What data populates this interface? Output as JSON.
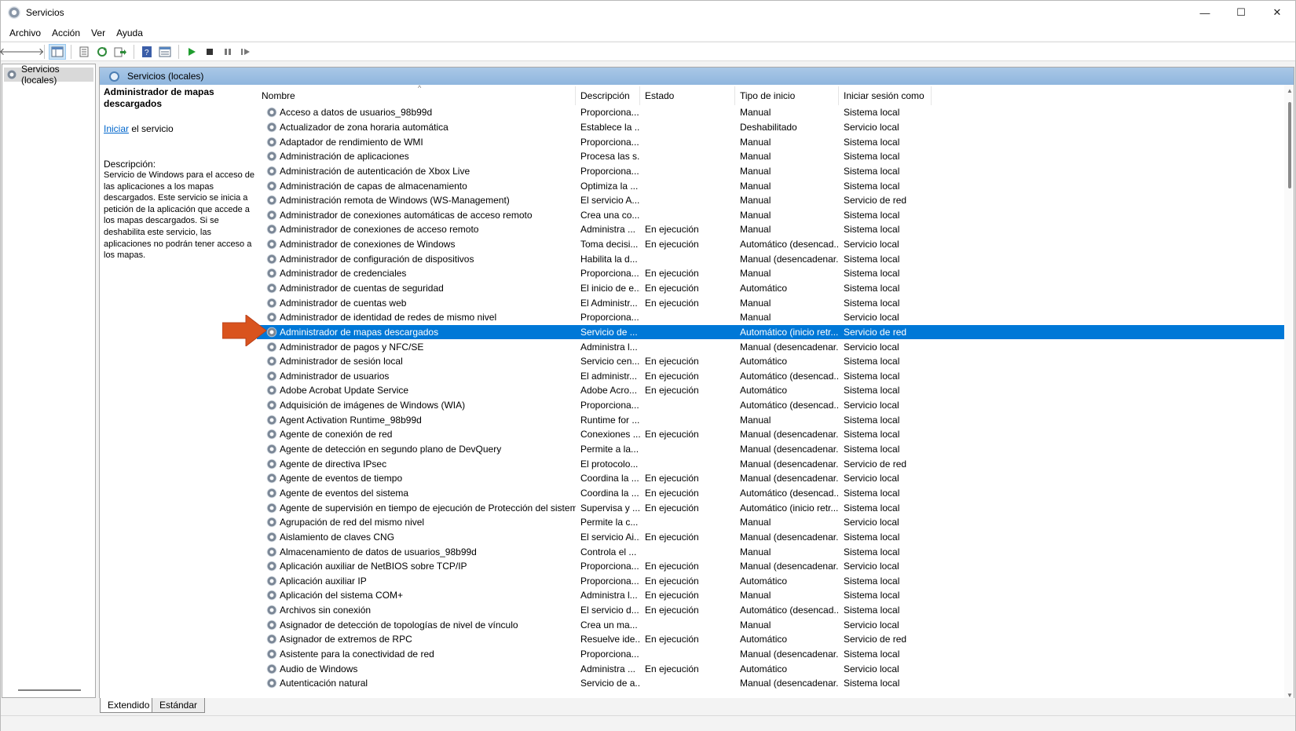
{
  "window": {
    "title": "Servicios"
  },
  "titlebar_buttons": {
    "minimize": "—",
    "maximize": "☐",
    "close": "✕"
  },
  "menu": [
    "Archivo",
    "Acción",
    "Ver",
    "Ayuda"
  ],
  "toolbar": [
    "back-icon",
    "forward-icon",
    "console-tree-icon",
    "properties-icon",
    "refresh-icon",
    "export-list-icon",
    "help-icon",
    "details-view-icon",
    "start-service-icon",
    "stop-service-icon",
    "pause-service-icon",
    "resume-service-icon"
  ],
  "tree": {
    "root_label": "Servicios (locales)"
  },
  "content": {
    "header_title": "Servicios (locales)"
  },
  "extended": {
    "title": "Administrador de mapas descargados",
    "action_link": "Iniciar",
    "action_suffix": " el servicio",
    "description_label": "Descripción:",
    "description": "Servicio de Windows para el acceso de las aplicaciones a los mapas descargados. Este servicio se inicia a petición de la aplicación que accede a los mapas descargados. Si se deshabilita este servicio, las aplicaciones no podrán tener acceso a los mapas."
  },
  "columns": {
    "name": "Nombre",
    "description": "Descripción",
    "status": "Estado",
    "startup": "Tipo de inicio",
    "logon": "Iniciar sesión como"
  },
  "services": [
    [
      "Acceso a datos de usuarios_98b99d",
      "Proporciona...",
      "",
      "Manual",
      "Sistema local"
    ],
    [
      "Actualizador de zona horaria automática",
      "Establece la ...",
      "",
      "Deshabilitado",
      "Servicio local"
    ],
    [
      "Adaptador de rendimiento de WMI",
      "Proporciona...",
      "",
      "Manual",
      "Sistema local"
    ],
    [
      "Administración de aplicaciones",
      "Procesa las s...",
      "",
      "Manual",
      "Sistema local"
    ],
    [
      "Administración de autenticación de Xbox Live",
      "Proporciona...",
      "",
      "Manual",
      "Sistema local"
    ],
    [
      "Administración de capas de almacenamiento",
      "Optimiza la ...",
      "",
      "Manual",
      "Sistema local"
    ],
    [
      "Administración remota de Windows (WS-Management)",
      "El servicio A...",
      "",
      "Manual",
      "Servicio de red"
    ],
    [
      "Administrador de conexiones automáticas de acceso remoto",
      "Crea una co...",
      "",
      "Manual",
      "Sistema local"
    ],
    [
      "Administrador de conexiones de acceso remoto",
      "Administra ...",
      "En ejecución",
      "Manual",
      "Sistema local"
    ],
    [
      "Administrador de conexiones de Windows",
      "Toma decisi...",
      "En ejecución",
      "Automático (desencad...",
      "Servicio local"
    ],
    [
      "Administrador de configuración de dispositivos",
      "Habilita la d...",
      "",
      "Manual (desencadenar...",
      "Sistema local"
    ],
    [
      "Administrador de credenciales",
      "Proporciona...",
      "En ejecución",
      "Manual",
      "Sistema local"
    ],
    [
      "Administrador de cuentas de seguridad",
      "El inicio de e...",
      "En ejecución",
      "Automático",
      "Sistema local"
    ],
    [
      "Administrador de cuentas web",
      "El Administr...",
      "En ejecución",
      "Manual",
      "Sistema local"
    ],
    [
      "Administrador de identidad de redes de mismo nivel",
      "Proporciona...",
      "",
      "Manual",
      "Servicio local"
    ],
    [
      "Administrador de mapas descargados",
      "Servicio de ...",
      "",
      "Automático (inicio retr...",
      "Servicio de red"
    ],
    [
      "Administrador de pagos y NFC/SE",
      "Administra l...",
      "",
      "Manual (desencadenar...",
      "Servicio local"
    ],
    [
      "Administrador de sesión local",
      "Servicio cen...",
      "En ejecución",
      "Automático",
      "Sistema local"
    ],
    [
      "Administrador de usuarios",
      "El administr...",
      "En ejecución",
      "Automático (desencad...",
      "Sistema local"
    ],
    [
      "Adobe Acrobat Update Service",
      "Adobe Acro...",
      "En ejecución",
      "Automático",
      "Sistema local"
    ],
    [
      "Adquisición de imágenes de Windows (WIA)",
      "Proporciona...",
      "",
      "Automático (desencad...",
      "Servicio local"
    ],
    [
      "Agent Activation Runtime_98b99d",
      "Runtime for ...",
      "",
      "Manual",
      "Sistema local"
    ],
    [
      "Agente de conexión de red",
      "Conexiones ...",
      "En ejecución",
      "Manual (desencadenar...",
      "Sistema local"
    ],
    [
      "Agente de detección en segundo plano de DevQuery",
      "Permite a la...",
      "",
      "Manual (desencadenar...",
      "Sistema local"
    ],
    [
      "Agente de directiva IPsec",
      "El protocolo...",
      "",
      "Manual (desencadenar...",
      "Servicio de red"
    ],
    [
      "Agente de eventos de tiempo",
      "Coordina la ...",
      "En ejecución",
      "Manual (desencadenar...",
      "Servicio local"
    ],
    [
      "Agente de eventos del sistema",
      "Coordina la ...",
      "En ejecución",
      "Automático (desencad...",
      "Sistema local"
    ],
    [
      "Agente de supervisión en tiempo de ejecución de Protección del sistema",
      "Supervisa y ...",
      "En ejecución",
      "Automático (inicio retr...",
      "Sistema local"
    ],
    [
      "Agrupación de red del mismo nivel",
      "Permite la c...",
      "",
      "Manual",
      "Servicio local"
    ],
    [
      "Aislamiento de claves CNG",
      "El servicio Ai...",
      "En ejecución",
      "Manual (desencadenar...",
      "Sistema local"
    ],
    [
      "Almacenamiento de datos de usuarios_98b99d",
      "Controla el ...",
      "",
      "Manual",
      "Sistema local"
    ],
    [
      "Aplicación auxiliar de NetBIOS sobre TCP/IP",
      "Proporciona...",
      "En ejecución",
      "Manual (desencadenar...",
      "Servicio local"
    ],
    [
      "Aplicación auxiliar IP",
      "Proporciona...",
      "En ejecución",
      "Automático",
      "Sistema local"
    ],
    [
      "Aplicación del sistema COM+",
      "Administra l...",
      "En ejecución",
      "Manual",
      "Sistema local"
    ],
    [
      "Archivos sin conexión",
      "El servicio d...",
      "En ejecución",
      "Automático (desencad...",
      "Sistema local"
    ],
    [
      "Asignador de detección de topologías de nivel de vínculo",
      "Crea un ma...",
      "",
      "Manual",
      "Servicio local"
    ],
    [
      "Asignador de extremos de RPC",
      "Resuelve ide...",
      "En ejecución",
      "Automático",
      "Servicio de red"
    ],
    [
      "Asistente para la conectividad de red",
      "Proporciona...",
      "",
      "Manual (desencadenar...",
      "Sistema local"
    ],
    [
      "Audio de Windows",
      "Administra ...",
      "En ejecución",
      "Automático",
      "Servicio local"
    ],
    [
      "Autenticación natural",
      "Servicio de a...",
      "",
      "Manual (desencadenar...",
      "Sistema local"
    ]
  ],
  "selected_index": 15,
  "tabs": {
    "extended": "Extendido",
    "standard": "Estándar"
  },
  "colors": {
    "selection": "#0078d7",
    "header_gradient": "#a9c7e6",
    "pointer_arrow": "#d9531e"
  }
}
